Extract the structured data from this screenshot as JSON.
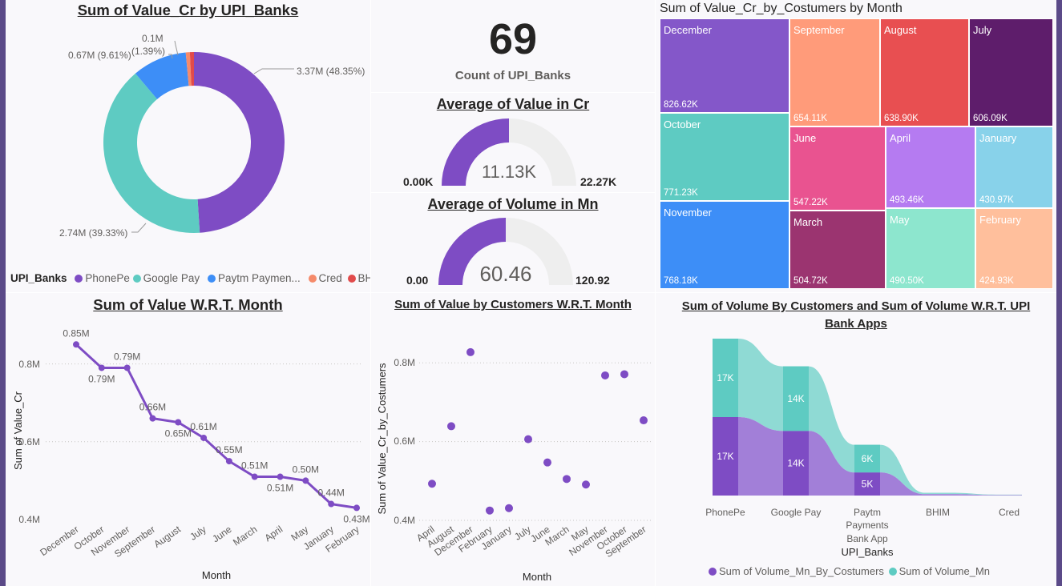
{
  "colors": {
    "accent": "#7e4cc4",
    "teal": "#5ecbc2",
    "blue": "#3d8ef7",
    "salmon": "#f58a6a",
    "red": "#e14b4b",
    "frame": "#5b4a88",
    "gauge_track": "#eeeeee"
  },
  "donut": {
    "title": "Sum of Value_Cr by UPI_Banks",
    "legend_title": "UPI_Banks",
    "legend_items": [
      "PhonePe",
      "Google Pay",
      "Paytm Paymen...",
      "Cred",
      "BHIM"
    ],
    "labels": {
      "phonepe": "3.37M (48.35%)",
      "google_pay": "2.74M (39.33%)",
      "paytm": "0.67M (9.61%)",
      "small_value": "0.1M",
      "small_pct": "(1.39%)"
    }
  },
  "kpi": {
    "value": "69",
    "label": "Count of UPI_Banks"
  },
  "gauge_value": {
    "title": "Average of Value in Cr",
    "value_label": "11.13K",
    "min_label": "0.00K",
    "max_label": "22.27K",
    "fraction": 0.5
  },
  "gauge_volume": {
    "title": "Average of Volume in Mn",
    "value_label": "60.46",
    "min_label": "0.00",
    "max_label": "120.92",
    "fraction": 0.5
  },
  "treemap": {
    "title": "Sum of Value_Cr_by_Costumers by Month",
    "cells": [
      {
        "name": "December",
        "value": "826.62K"
      },
      {
        "name": "October",
        "value": "771.23K"
      },
      {
        "name": "November",
        "value": "768.18K"
      },
      {
        "name": "September",
        "value": "654.11K"
      },
      {
        "name": "August",
        "value": "638.90K"
      },
      {
        "name": "July",
        "value": "606.09K"
      },
      {
        "name": "June",
        "value": "547.22K"
      },
      {
        "name": "March",
        "value": "504.72K"
      },
      {
        "name": "April",
        "value": "493.46K"
      },
      {
        "name": "January",
        "value": "430.97K"
      },
      {
        "name": "May",
        "value": "490.50K"
      },
      {
        "name": "February",
        "value": "424.93K"
      }
    ]
  },
  "line_panel": {
    "title": "Sum of Value W.R.T. Month",
    "xlabel": "Month",
    "ylabel": "Sum of Value_Cr",
    "y_ticks": [
      "0.8M",
      "0.6M",
      "0.4M"
    ]
  },
  "scatter_panel": {
    "title": "Sum of Value by Customers W.R.T. Month",
    "xlabel": "Month",
    "ylabel": "Sum of Value_Cr_by_Costumers",
    "y_ticks": [
      "0.8M",
      "0.6M",
      "0.4M"
    ]
  },
  "ribbon_panel": {
    "title_line1": "Sum of Volume By Customers and Sum of Volume W.R.T. UPI",
    "title_line2": "Bank Apps",
    "xlabel": "UPI_Banks",
    "categories": [
      "PhonePe",
      "Google Pay",
      "Paytm",
      "BHIM",
      "Cred"
    ],
    "paytm_line2": "Payments",
    "paytm_line3": "Bank App",
    "legend": [
      "Sum of Volume_Mn_By_Costumers",
      "Sum of Volume_Mn"
    ]
  },
  "chart_data": [
    {
      "type": "pie",
      "title": "Sum of Value_Cr by UPI_Banks",
      "categories": [
        "PhonePe",
        "Google Pay",
        "Paytm Payments Bank App",
        "Cred",
        "BHIM"
      ],
      "values": [
        3.37,
        2.74,
        0.67,
        0.05,
        0.05
      ],
      "percents": [
        48.35,
        39.33,
        9.61,
        1.39,
        1.32
      ],
      "colors": [
        "#7e4cc4",
        "#5ecbc2",
        "#3d8ef7",
        "#f58a6a",
        "#e14b4b"
      ],
      "legend_position": "bottom"
    },
    {
      "type": "line",
      "title": "Sum of Value W.R.T. Month",
      "xlabel": "Month",
      "ylabel": "Sum of Value_Cr",
      "categories": [
        "December",
        "October",
        "November",
        "September",
        "August",
        "July",
        "June",
        "March",
        "April",
        "May",
        "January",
        "February"
      ],
      "values": [
        0.85,
        0.79,
        0.79,
        0.66,
        0.65,
        0.61,
        0.55,
        0.51,
        0.51,
        0.5,
        0.44,
        0.43
      ],
      "value_labels": [
        "0.85M",
        "0.79M",
        "0.79M",
        "0.66M",
        "0.65M",
        "0.61M",
        "0.55M",
        "0.51M",
        "0.51M",
        "0.50M",
        "0.44M",
        "0.43M"
      ],
      "ylim": [
        0.4,
        0.9
      ],
      "y_ticks": [
        0.4,
        0.6,
        0.8
      ],
      "grid": true
    },
    {
      "type": "scatter",
      "title": "Sum of Value by Customers W.R.T. Month",
      "xlabel": "Month",
      "ylabel": "Sum of Value_Cr_by_Costumers",
      "categories": [
        "April",
        "August",
        "December",
        "February",
        "January",
        "July",
        "June",
        "March",
        "May",
        "November",
        "October",
        "September"
      ],
      "values": [
        0.493,
        0.639,
        0.827,
        0.425,
        0.431,
        0.606,
        0.547,
        0.505,
        0.491,
        0.768,
        0.771,
        0.654
      ],
      "ylim": [
        0.4,
        0.9
      ],
      "y_ticks": [
        0.4,
        0.6,
        0.8
      ],
      "grid": true
    },
    {
      "type": "area",
      "title": "Sum of Volume By Customers and Sum of Volume W.R.T. UPI Bank Apps",
      "xlabel": "UPI_Banks",
      "categories": [
        "PhonePe",
        "Google Pay",
        "Paytm Payments Bank App",
        "BHIM",
        "Cred"
      ],
      "series": [
        {
          "name": "Sum of Volume_Mn_By_Costumers",
          "values": [
            17,
            14,
            5,
            0.3,
            0.1
          ],
          "labels": [
            "17K",
            "14K",
            "5K",
            "",
            ""
          ]
        },
        {
          "name": "Sum of Volume_Mn",
          "values": [
            17,
            14,
            6,
            0.3,
            0.1
          ],
          "labels": [
            "17K",
            "14K",
            "6K",
            "",
            ""
          ]
        }
      ],
      "stacked": true,
      "legend_position": "bottom"
    }
  ]
}
